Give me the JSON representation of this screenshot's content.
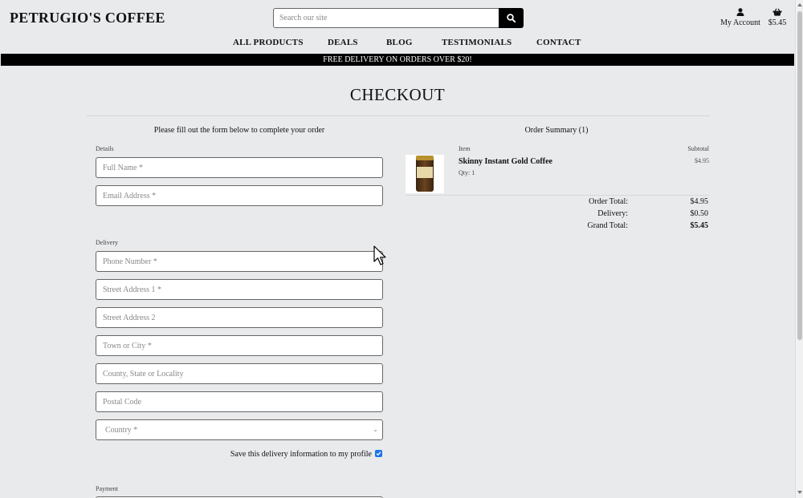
{
  "header": {
    "brand": "PETRUGIO'S COFFEE",
    "search_placeholder": "Search our site",
    "account_label": "My Account",
    "cart_total": "$5.45"
  },
  "nav": {
    "items": [
      "ALL PRODUCTS",
      "DEALS",
      "BLOG",
      "TESTIMONIALS",
      "CONTACT"
    ]
  },
  "banner": "FREE DELIVERY ON ORDERS OVER $20!",
  "checkout": {
    "title": "CHECKOUT",
    "form_intro": "Please fill out the form below to complete your order",
    "details_label": "Details",
    "delivery_label": "Delivery",
    "payment_label": "Payment",
    "fields": {
      "full_name": "Full Name *",
      "email": "Email Address *",
      "phone": "Phone Number *",
      "street1": "Street Address 1 *",
      "street2": "Street Address 2",
      "town": "Town or City *",
      "county": "County, State or Locality",
      "postcode": "Postal Code",
      "country": "Country *"
    },
    "save_info_label": "Save this delivery information to my profile",
    "save_info_checked": true
  },
  "summary": {
    "title": "Order Summary (1)",
    "item_header": "Item",
    "subtotal_header": "Subtotal",
    "items": [
      {
        "name": "Skinny Instant Gold Coffee",
        "qty": "Qty: 1",
        "subtotal": "$4.95"
      }
    ],
    "order_total_label": "Order Total:",
    "order_total": "$4.95",
    "delivery_label": "Delivery:",
    "delivery": "$0.50",
    "grand_total_label": "Grand Total:",
    "grand_total": "$5.45"
  }
}
